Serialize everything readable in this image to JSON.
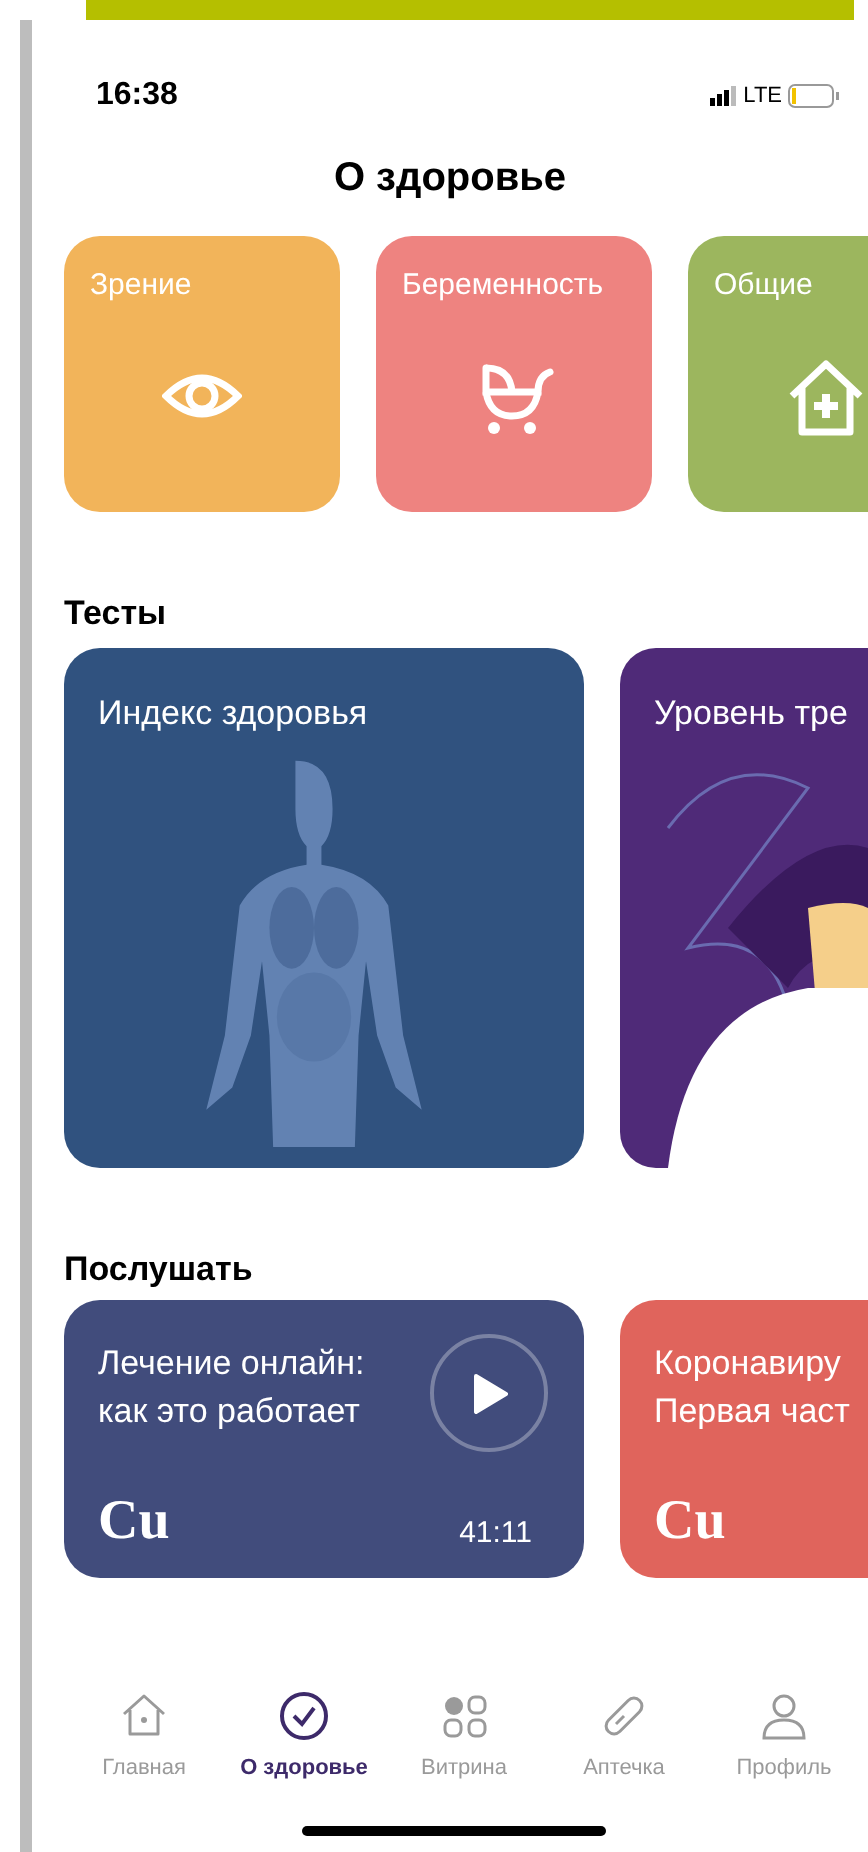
{
  "status_bar": {
    "time": "16:38",
    "network": "LTE"
  },
  "title": "О здоровье",
  "categories": [
    {
      "label": "Зрение",
      "kind": "eye",
      "color": "#f2b45a"
    },
    {
      "label": "Беременность",
      "kind": "stroller",
      "color": "#ee8380"
    },
    {
      "label": "Общие",
      "kind": "house",
      "color": "#9cb65e"
    }
  ],
  "tests": {
    "heading": "Тесты",
    "cards": [
      {
        "title": "Индекс здоровья",
        "kind": "anatomy",
        "color": "#30527f"
      },
      {
        "title": "Уровень тре",
        "kind": "person",
        "color": "#4f2a78"
      }
    ]
  },
  "listen": {
    "heading": "Послушать",
    "cards": [
      {
        "title": "Лечение онлайн:\nкак это работает",
        "logo": "Cu",
        "duration": "41:11",
        "color": "#414c7c"
      },
      {
        "title": "Коронавиру\nПервая част",
        "logo": "Cu",
        "color": "#e0645c"
      }
    ]
  },
  "tab_bar": [
    {
      "label": "Главная",
      "kind": "home",
      "selected": false
    },
    {
      "label": "О здоровье",
      "kind": "check",
      "selected": true
    },
    {
      "label": "Витрина",
      "kind": "grid",
      "selected": false
    },
    {
      "label": "Аптечка",
      "kind": "pill",
      "selected": false
    },
    {
      "label": "Профиль",
      "kind": "person",
      "selected": false
    }
  ]
}
